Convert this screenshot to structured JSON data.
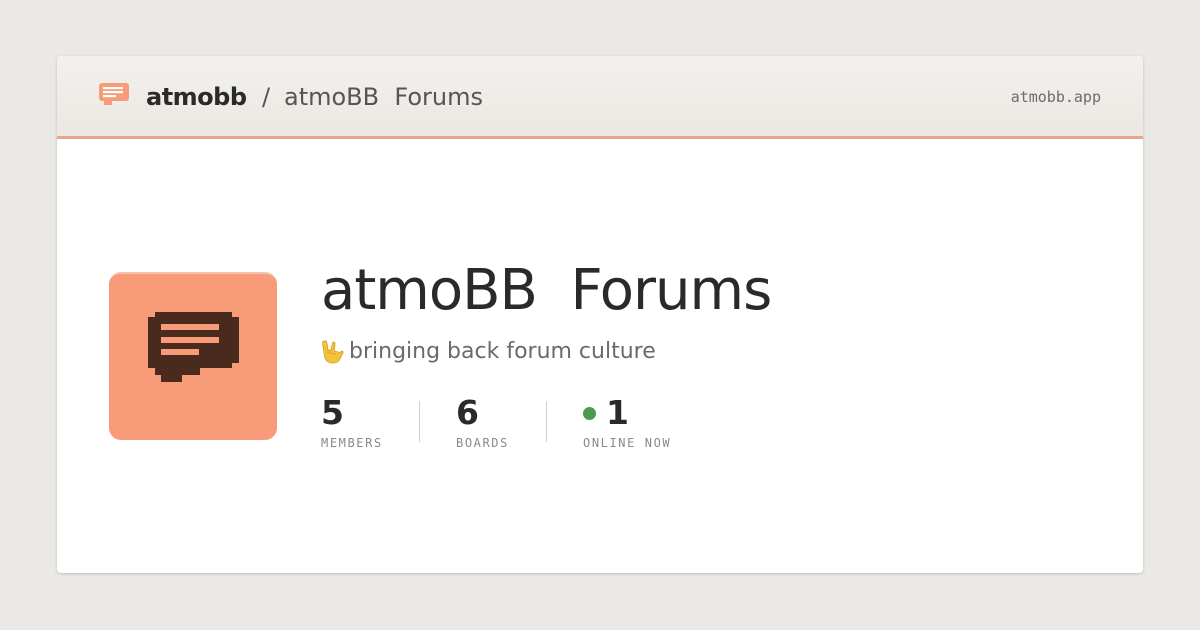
{
  "header": {
    "brand": "atmobb",
    "separator": "/",
    "forum_name": "atmoBB  Forums",
    "domain": "atmobb.app"
  },
  "main": {
    "title": "atmoBB  Forums",
    "tagline_icon": "hand-horns-emoji",
    "tagline": "bringing back forum culture"
  },
  "stats": {
    "members": {
      "value": "5",
      "label": "MEMBERS"
    },
    "boards": {
      "value": "6",
      "label": "BOARDS"
    },
    "online": {
      "value": "1",
      "label": "ONLINE NOW"
    }
  },
  "icons": {
    "logo": "chat-bubble-icon",
    "online_indicator": "online-dot-icon"
  },
  "colors": {
    "accent": "#f79b78",
    "accent_border": "#eaa488",
    "logo_ink": "#4a2a1c",
    "online": "#4b9a4e",
    "text": "#2a2a2a",
    "muted": "#8a8a8a"
  }
}
